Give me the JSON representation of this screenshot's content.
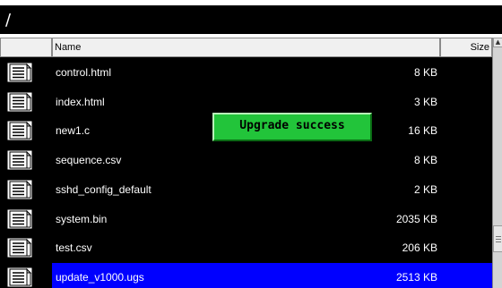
{
  "path_bar": {
    "path": "/"
  },
  "file_list": {
    "columns": {
      "name": "Name",
      "size": "Size"
    },
    "rows": [
      {
        "name": "control.html",
        "size": "8 KB",
        "icon": "document-icon",
        "selected": false
      },
      {
        "name": "index.html",
        "size": "3 KB",
        "icon": "document-icon",
        "selected": false
      },
      {
        "name": "new1.c",
        "size": "16 KB",
        "icon": "document-icon",
        "selected": false
      },
      {
        "name": "sequence.csv",
        "size": "8 KB",
        "icon": "document-icon",
        "selected": false
      },
      {
        "name": "sshd_config_default",
        "size": "2 KB",
        "icon": "document-icon",
        "selected": false
      },
      {
        "name": "system.bin",
        "size": "2035 KB",
        "icon": "document-icon",
        "selected": false
      },
      {
        "name": "test.csv",
        "size": "206 KB",
        "icon": "document-icon",
        "selected": false
      },
      {
        "name": "update_v1000.ugs",
        "size": "2513 KB",
        "icon": "document-icon",
        "selected": true
      }
    ]
  },
  "notification": {
    "message": "Upgrade success",
    "color": "#22c43a"
  },
  "colors": {
    "background": "#000000",
    "selection": "#0000ff",
    "text": "#ffffff"
  }
}
